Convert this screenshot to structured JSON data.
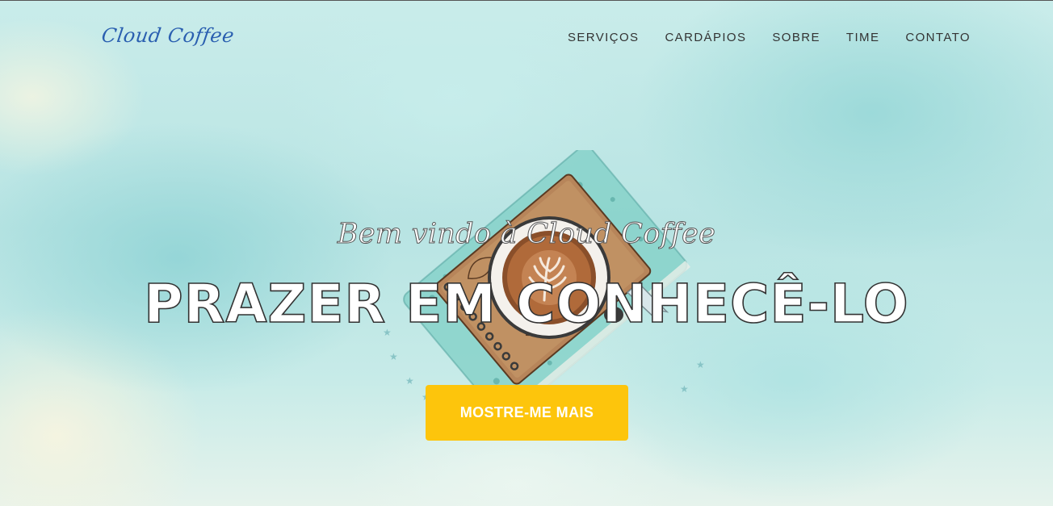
{
  "brand": {
    "logo_text": "Cloud Coffee",
    "logo_color": "#2a5fb0"
  },
  "nav": {
    "items": [
      {
        "label": "SERVIÇOS"
      },
      {
        "label": "CARDÁPIOS"
      },
      {
        "label": "SOBRE"
      },
      {
        "label": "TIME"
      },
      {
        "label": "CONTATO"
      }
    ]
  },
  "hero": {
    "subtitle": "Bem vindo à Cloud Coffee",
    "headline": "PRAZER EM CONHECÊ-LO",
    "cta_label": "MOSTRE-ME MAIS",
    "cta_color": "#fdc50c",
    "illustration": "coffee-cup-on-notebook-illustration"
  }
}
